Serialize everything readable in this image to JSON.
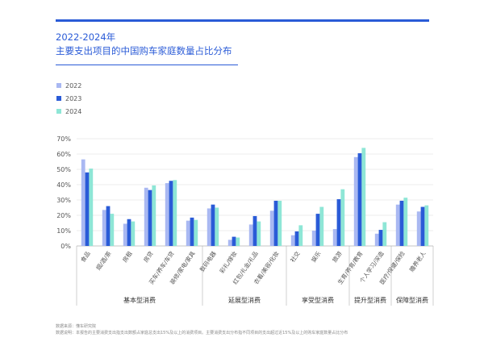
{
  "title": {
    "line1": "2022-2024年",
    "line2": "主要支出项目的中国购车家庭数量占比分布"
  },
  "colors": {
    "accent": "#2a5bd7",
    "axis_text": "#555555",
    "grid": "#d9d9d9",
    "axis_line": "#b0b0b0"
  },
  "footer": {
    "source": "数据来源：懂车研究院",
    "note": "数据说明：本报告的主要消费支出指支出数额占家庭总支出15%及以上的消费项目。主要消费支出分布指不同项目的支出超过近15%及以上的购车家庭数量占比分布"
  },
  "chart_data": {
    "type": "bar",
    "title": "2022-2024年 主要支出项目的中国购车家庭数量占比分布",
    "xlabel": "",
    "ylabel": "",
    "ylim": [
      0,
      70
    ],
    "yticks": [
      "0%",
      "10%",
      "20%",
      "30%",
      "40%",
      "50%",
      "60%",
      "70%"
    ],
    "grid": true,
    "legend_position": "top-left",
    "categories": [
      "食品",
      "烟/酒/茶",
      "房租",
      "房贷",
      "买车/养车/车贷",
      "装修/家电/家具",
      "数码电器",
      "彩礼/嫁妆",
      "红包/礼金/礼品",
      "衣着/美容/化妆",
      "社交",
      "娱乐",
      "旅游",
      "生育/养育/教育",
      "个人学习/深造",
      "医疗/保健/保险",
      "赡养老人"
    ],
    "groups": [
      {
        "label": "基本型消费",
        "count": 6
      },
      {
        "label": "延展型消费",
        "count": 4
      },
      {
        "label": "享受型消费",
        "count": 3
      },
      {
        "label": "提升型消费",
        "count": 2
      },
      {
        "label": "保障型消费",
        "count": 2
      }
    ],
    "series": [
      {
        "name": "2022",
        "color": "#a9b8f2",
        "values": [
          56.5,
          23.5,
          14.5,
          38,
          41,
          16.5,
          24.5,
          4,
          14,
          23,
          7,
          10,
          11,
          58,
          8,
          27,
          22.5
        ]
      },
      {
        "name": "2023",
        "color": "#2a5bd7",
        "values": [
          48,
          26,
          17.5,
          36.5,
          42.5,
          18.5,
          27,
          6,
          19.5,
          29.5,
          9.5,
          21,
          30.5,
          60.5,
          10.5,
          29.5,
          25.5
        ]
      },
      {
        "name": "2024",
        "color": "#8ee6d6",
        "values": [
          50.5,
          21,
          16,
          39.5,
          43,
          17,
          25,
          5.5,
          16,
          29.5,
          13.5,
          25.5,
          37,
          64,
          15.5,
          31.5,
          26.5
        ]
      }
    ]
  }
}
